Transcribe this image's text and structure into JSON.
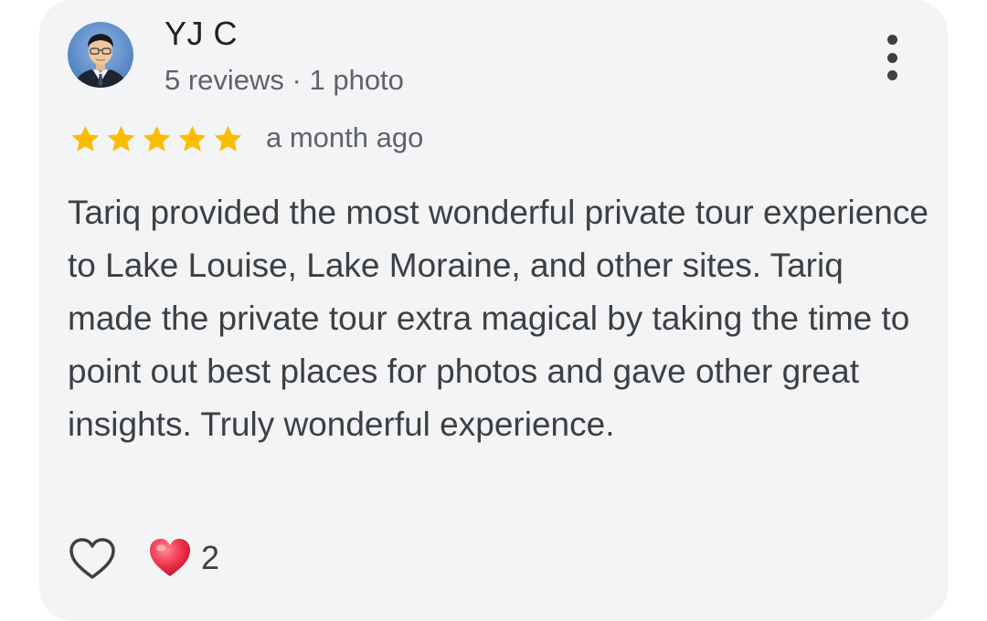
{
  "review": {
    "reviewer_name": "YJ C",
    "reviewer_meta": "5 reviews · 1 photo",
    "rating": 5,
    "rating_max": 5,
    "date": "a month ago",
    "text": "Tariq provided the most wonderful private tour experience to Lake Louise, Lake Moraine, and other sites. Tariq made the private tour extra magical by taking the time to point out best places for photos and gave other great insights. Truly wonderful experience.",
    "reaction_count": "2"
  },
  "icons": {
    "more": "more-vert-icon",
    "star": "star-icon",
    "like": "heart-outline-icon",
    "reaction": "red-heart-icon"
  },
  "colors": {
    "card_background": "#f3f4f6",
    "star": "#fbbc04",
    "heart": "#e8334a",
    "text_primary": "#202124",
    "text_secondary": "#5f6368"
  }
}
